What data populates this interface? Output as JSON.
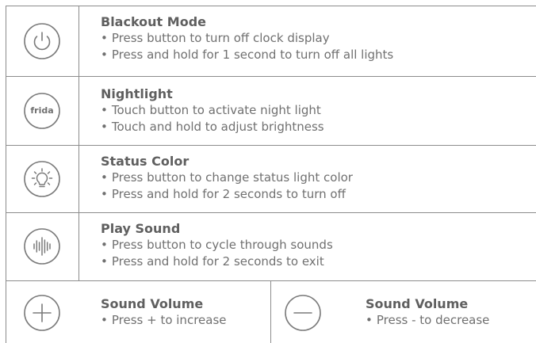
{
  "rows": [
    {
      "title": "Blackout Mode",
      "bullets": [
        "Press button to turn off clock display",
        "Press and hold for 1 second to turn off all lights"
      ],
      "icon": "power-icon"
    },
    {
      "title": "Nightlight",
      "bullets": [
        "Touch button to activate night light",
        "Touch and hold to adjust brightness"
      ],
      "icon": "frida-logo-icon",
      "icon_text": "frida"
    },
    {
      "title": "Status Color",
      "bullets": [
        "Press button to change status light color",
        "Press and hold for 2 seconds to turn off"
      ],
      "icon": "lightbulb-icon"
    },
    {
      "title": "Play Sound",
      "bullets": [
        "Press button to cycle through sounds",
        "Press and hold for 2 seconds to exit"
      ],
      "icon": "sound-wave-icon"
    }
  ],
  "volume": [
    {
      "title": "Sound Volume",
      "bullets": [
        "Press + to increase"
      ],
      "icon": "plus-icon"
    },
    {
      "title": "Sound Volume",
      "bullets": [
        "Press - to decrease"
      ],
      "icon": "minus-icon"
    }
  ],
  "colors": {
    "line": "#8c8c8c",
    "text": "#707070",
    "title": "#5f5f5f",
    "icon_stroke": "#7a7a7a"
  }
}
